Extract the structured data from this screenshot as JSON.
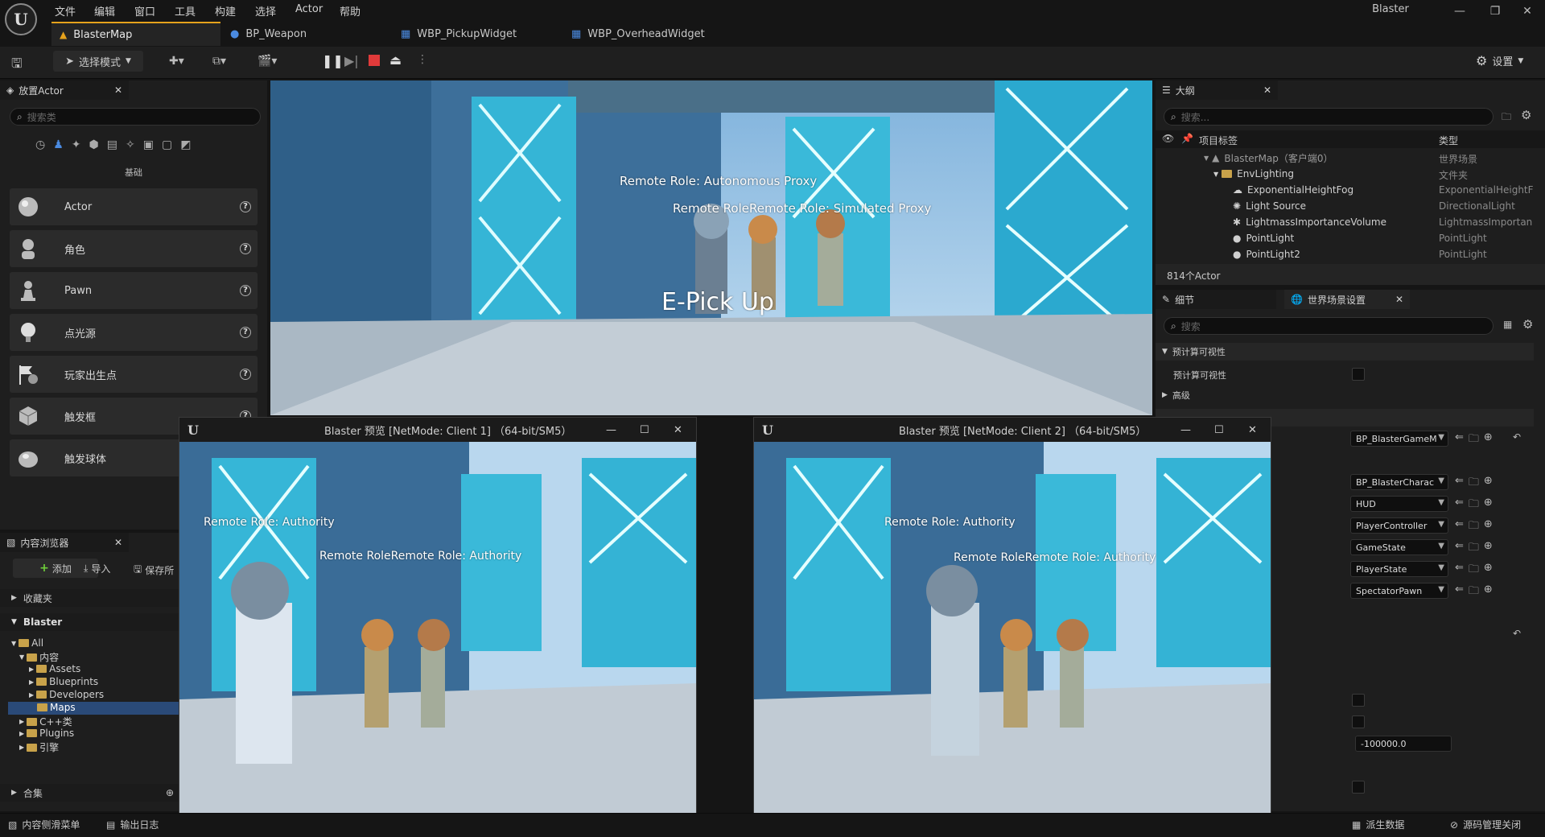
{
  "app": {
    "window_title": "Blaster"
  },
  "menu": [
    "文件",
    "编辑",
    "窗口",
    "工具",
    "构建",
    "选择",
    "Actor",
    "帮助"
  ],
  "tabs": [
    {
      "label": "BlasterMap",
      "icon": "level-icon",
      "active": true
    },
    {
      "label": "BP_Weapon",
      "icon": "blueprint-icon",
      "active": false
    },
    {
      "label": "WBP_PickupWidget",
      "icon": "widget-blueprint-icon",
      "active": false
    },
    {
      "label": "WBP_OverheadWidget",
      "icon": "widget-blueprint-icon",
      "active": false
    }
  ],
  "toolbar": {
    "mode_label": "选择模式",
    "settings_label": "设置"
  },
  "place_actors": {
    "title": "放置Actor",
    "search_placeholder": "搜索类",
    "category_label": "基础",
    "items": [
      "Actor",
      "角色",
      "Pawn",
      "点光源",
      "玩家出生点",
      "触发框",
      "触发球体"
    ]
  },
  "content_browser": {
    "title": "内容浏览器",
    "add_label": "添加",
    "import_label": "导入",
    "save_label": "保存所",
    "favorites_label": "收藏夹",
    "project_label": "Blaster",
    "collections_label": "合集",
    "tree": [
      "All",
      "内容",
      "Assets",
      "Blueprints",
      "Developers",
      "Maps",
      "C++类",
      "Plugins",
      "引擎"
    ]
  },
  "outliner": {
    "title": "大纲",
    "search_placeholder": "搜索...",
    "col_label": "项目标签",
    "col_type": "类型",
    "rows": [
      {
        "label": "BlasterMap（客户端0）",
        "type": "世界场景"
      },
      {
        "label": "EnvLighting",
        "type": "文件夹"
      },
      {
        "label": "ExponentialHeightFog",
        "type": "ExponentialHeightF"
      },
      {
        "label": "Light Source",
        "type": "DirectionalLight"
      },
      {
        "label": "LightmassImportanceVolume",
        "type": "LightmassImportan"
      },
      {
        "label": "PointLight",
        "type": "PointLight"
      },
      {
        "label": "PointLight2",
        "type": "PointLight"
      }
    ],
    "count": "814个Actor"
  },
  "details": {
    "tab_details": "细节",
    "tab_world": "世界场景设置",
    "search_placeholder": "搜索",
    "section_precomputed": "预计算可视性",
    "row_precomputed": "预计算可视性",
    "section_advanced": "高级",
    "dropdowns": [
      "BP_BlasterGameM",
      "BP_BlasterCharac",
      "HUD",
      "PlayerController",
      "GameState",
      "PlayerState",
      "SpectatorPawn"
    ],
    "kill_z": "-100000.0"
  },
  "viewport_main": {
    "label_autonomous": "Remote Role: Autonomous Proxy",
    "label_simulated": "Remote RoleRemote Role: Simulated Proxy",
    "pickup": "E-Pick Up"
  },
  "preview_client1": {
    "title": "Blaster 预览 [NetMode: Client 1]  （64-bit/SM5）",
    "label_a": "Remote Role: Authority",
    "label_b": "Remote RoleRemote Role: Authority"
  },
  "preview_client2": {
    "title": "Blaster 预览 [NetMode: Client 2]  （64-bit/SM5）",
    "label_a": "Remote Role: Authority",
    "label_b": "Remote RoleRemote Role: Authority"
  },
  "statusbar": {
    "drawer": "内容侧滑菜单",
    "output_log": "输出日志",
    "derived_data": "派生数据",
    "source_control": "源码管理关闭"
  },
  "colors": {
    "accent": "#e5a21c",
    "panel": "#1e1e1e",
    "sky": "#9fc7e6",
    "neon": "#5be4ff"
  }
}
